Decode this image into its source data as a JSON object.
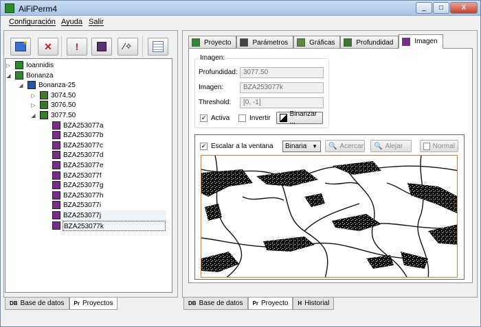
{
  "window": {
    "title": "AiFiPerm4",
    "buttons": [
      "_",
      "□",
      "X"
    ]
  },
  "menu": [
    "Configuración",
    "Ayuda",
    "Salir"
  ],
  "left_toolbar": [
    {
      "icon": "add-project-icon"
    },
    {
      "icon": "delete-icon"
    },
    {
      "icon": "warning-icon"
    },
    {
      "icon": "analyze-icon"
    },
    {
      "icon": "wand-icon"
    },
    {
      "icon": "notes-icon"
    }
  ],
  "tree": [
    {
      "label": "Ioannidis",
      "level": 1,
      "expander": "▷"
    },
    {
      "label": "Bonanza",
      "level": 1,
      "expander": "◢"
    },
    {
      "label": "Bonanza-25",
      "level": 2,
      "expander": "◢"
    },
    {
      "label": "3074.50",
      "level": 3,
      "expander": "▷"
    },
    {
      "label": "3076.50",
      "level": 3,
      "expander": "▷"
    },
    {
      "label": "3077.50",
      "level": 3,
      "expander": "◢"
    },
    {
      "label": "BZA253077a",
      "level": 4,
      "expander": ""
    },
    {
      "label": "BZA253077b",
      "level": 4,
      "expander": ""
    },
    {
      "label": "BZA253077c",
      "level": 4,
      "expander": ""
    },
    {
      "label": "BZA253077d",
      "level": 4,
      "expander": ""
    },
    {
      "label": "BZA253077e",
      "level": 4,
      "expander": ""
    },
    {
      "label": "BZA253077f",
      "level": 4,
      "expander": ""
    },
    {
      "label": "BZA253077g",
      "level": 4,
      "expander": ""
    },
    {
      "label": "BZA253077h",
      "level": 4,
      "expander": ""
    },
    {
      "label": "BZA253077i",
      "level": 4,
      "expander": ""
    },
    {
      "label": "BZA253077j",
      "level": 4,
      "expander": ""
    },
    {
      "label": "BZA253077k",
      "level": 4,
      "expander": ""
    }
  ],
  "left_bottom_tabs": [
    {
      "tag": "DB",
      "label": "Base de datos"
    },
    {
      "tag": "Pr",
      "label": "Proyectos"
    }
  ],
  "right_tabs": [
    {
      "label": "Proyecto",
      "color": "#2d8a2d"
    },
    {
      "label": "Parámetros",
      "color": "#444444"
    },
    {
      "label": "Gráficas",
      "color": "#5a8a3a"
    },
    {
      "label": "Profundidad",
      "color": "#3a7a2a"
    },
    {
      "label": "Imagen",
      "color": "#7a2a8a"
    }
  ],
  "imagen_group": {
    "title": "Imagen:",
    "profundidad_label": "Profundidad:",
    "profundidad_value": "3077.50",
    "imagen_label": "Imagen:",
    "imagen_value": "BZA253077k",
    "threshold_label": "Threshold:",
    "threshold_value": "[0, -1]",
    "activa_label": "Activa",
    "invertir_label": "Invertir",
    "binarizar_label": "Binarizar ..."
  },
  "viewer": {
    "escalar_label": "Escalar a la ventana",
    "mode_value": "Binaria",
    "acercar_label": "Acercar",
    "alejar_label": "Alejar",
    "normal_label": "Normal"
  },
  "right_bottom_tabs": [
    {
      "tag": "DB",
      "label": "Base de datos"
    },
    {
      "tag": "Pr",
      "label": "Proyecto"
    },
    {
      "tag": "H",
      "label": "Historial"
    }
  ]
}
